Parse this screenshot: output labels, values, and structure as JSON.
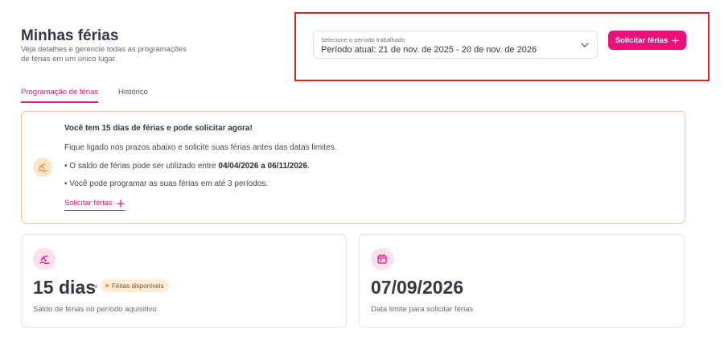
{
  "header": {
    "title": "Minhas férias",
    "description": "Veja detalhes e gerencie todas as programações de férias em um único lugar."
  },
  "period_select": {
    "label": "Selecione o período trabalhado",
    "value": "Período atual: 21 de nov. de 2025 - 20 de nov. de 2026"
  },
  "primary_button": {
    "label": "Solicitar férias",
    "icon": "plus-icon"
  },
  "tabs": [
    {
      "label": "Programação de férias",
      "active": true
    },
    {
      "label": "Histórico",
      "active": false
    }
  ],
  "alert": {
    "icon": "beach-icon",
    "title": "Você tem 15 dias de férias e pode solicitar agora!",
    "line1": "Fique ligado nos prazos abaixo e solicite suas férias antes das datas limites.",
    "line2_prefix": "• O saldo de férias pode ser utilizado entre ",
    "line2_bold": "04/04/2026 a 06/11/2026",
    "line2_suffix": ".",
    "line3": "• Você pode programar as suas férias em até 3 períodos.",
    "link_label": "Solicitar férias"
  },
  "stats": [
    {
      "icon": "beach-icon",
      "value": "15 dias",
      "badge": "Férias disponíveis",
      "caption": "Saldo de férias no período aquisitivo"
    },
    {
      "icon": "calendar-icon",
      "value": "07/09/2026",
      "caption": "Data limite para solicitar férias"
    }
  ],
  "colors": {
    "accent": "#e8127a",
    "highlight_border": "#e01e25",
    "alert_border": "#f2c896",
    "badge_bg": "#fdecd6"
  }
}
